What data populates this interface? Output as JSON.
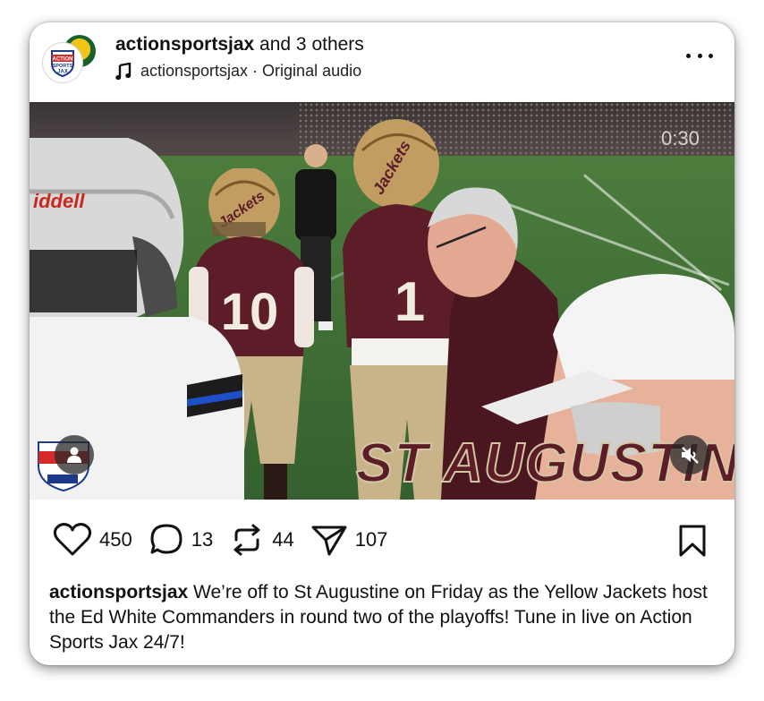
{
  "header": {
    "username": "actionsportsjax",
    "collab_suffix": " and 3 others",
    "audio_label": "actionsportsjax · Original audio"
  },
  "avatar": {
    "logo_line1": "ACTION",
    "logo_line2": "SPORTS",
    "logo_line3": "JAX"
  },
  "media": {
    "timer": "0:30",
    "overlay_text": "ST AUGUSTINE",
    "helmet_text": "Jackets",
    "jersey_numbers": [
      "10",
      "1"
    ]
  },
  "actions": {
    "likes": "450",
    "comments": "13",
    "reposts": "44",
    "shares": "107"
  },
  "caption": {
    "username": "actionsportsjax",
    "text": " We’re off to St Augustine on Friday as the Yellow Jackets host the Ed White Commanders in round two of the playoffs! Tune in live on Action Sports Jax 24/7!"
  },
  "colors": {
    "maroon": "#5c1d28",
    "gold": "#c9a86a",
    "field_green": "#3d6c34"
  }
}
